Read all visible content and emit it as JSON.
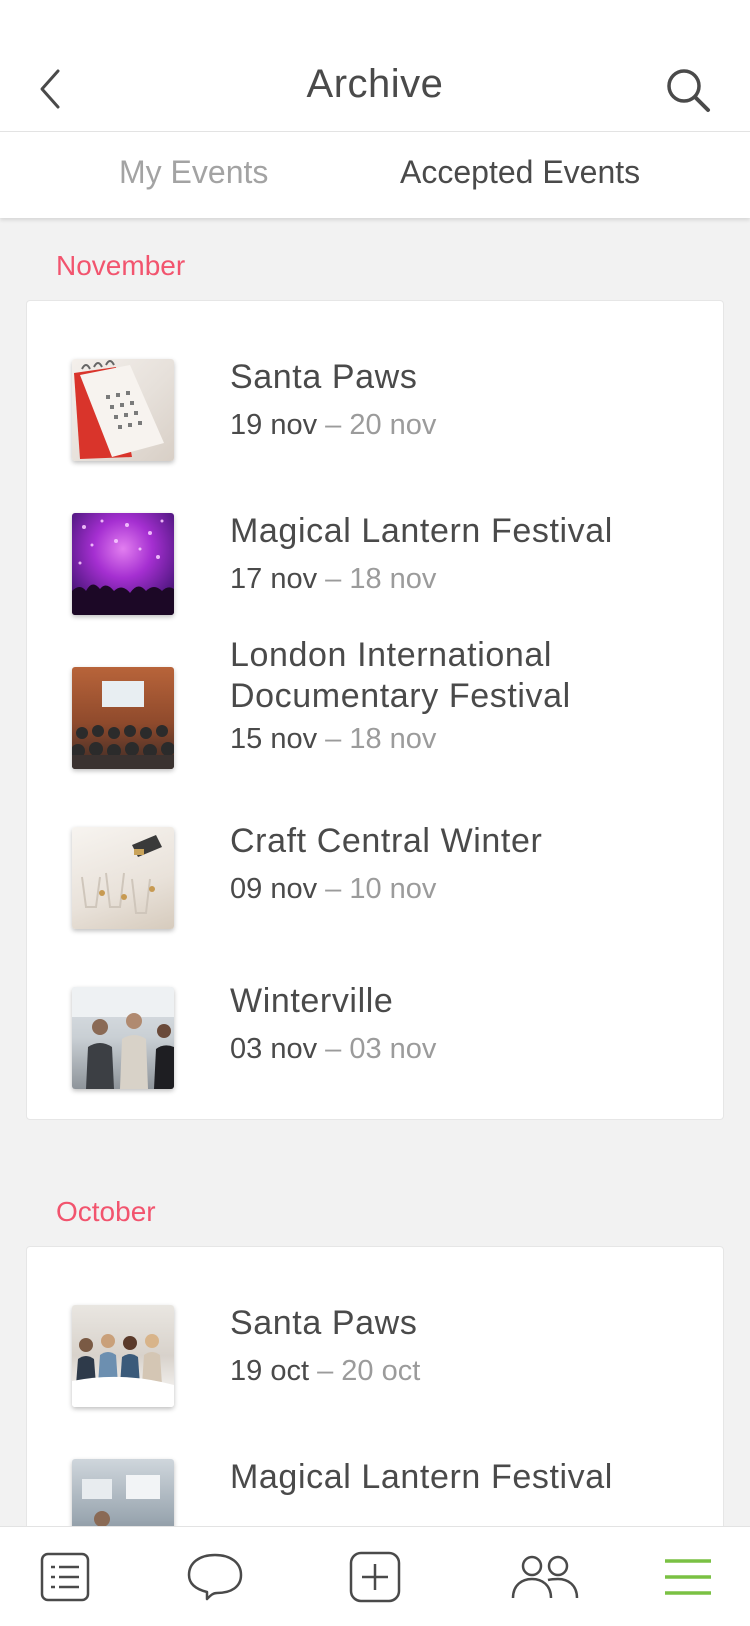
{
  "header": {
    "title": "Archive",
    "back_icon": "chevron-left-icon",
    "search_icon": "search-icon"
  },
  "tabs": [
    {
      "label": "My Events",
      "active": false
    },
    {
      "label": "Accepted Events",
      "active": true
    }
  ],
  "colors": {
    "month_label": "#f2546e",
    "menu_active": "#7ac143",
    "text_primary": "#4a4a4a",
    "text_secondary": "#9b9b9b"
  },
  "sections": [
    {
      "month": "November",
      "events": [
        {
          "name": "Santa Paws",
          "start": "19 nov",
          "sep": "–",
          "end": "20 nov",
          "thumb": "calendar-photo"
        },
        {
          "name": "Magical Lantern Festival",
          "start": "17 nov",
          "sep": "–",
          "end": "18 nov",
          "thumb": "concert-crowd-photo"
        },
        {
          "name": "London International Documentary Festival",
          "start": "15 nov",
          "sep": "–",
          "end": "18 nov",
          "thumb": "conference-hall-photo"
        },
        {
          "name": "Craft Central Winter",
          "start": "09 nov",
          "sep": "–",
          "end": "10 nov",
          "thumb": "champagne-glasses-photo"
        },
        {
          "name": "Winterville",
          "start": "03 nov",
          "sep": "–",
          "end": "03 nov",
          "thumb": "business-people-photo"
        }
      ]
    },
    {
      "month": "October",
      "events": [
        {
          "name": "Santa Paws",
          "start": "19 oct",
          "sep": "–",
          "end": "20 oct",
          "thumb": "team-meeting-photo"
        },
        {
          "name": "Magical Lantern Festival",
          "start": "",
          "sep": "",
          "end": "",
          "thumb": "office-desk-photo"
        }
      ]
    }
  ],
  "tabbar": [
    {
      "icon": "list-icon",
      "active": false
    },
    {
      "icon": "chat-bubble-icon",
      "active": false
    },
    {
      "icon": "add-square-icon",
      "active": false
    },
    {
      "icon": "people-icon",
      "active": false
    },
    {
      "icon": "hamburger-menu-icon",
      "active": true
    }
  ]
}
